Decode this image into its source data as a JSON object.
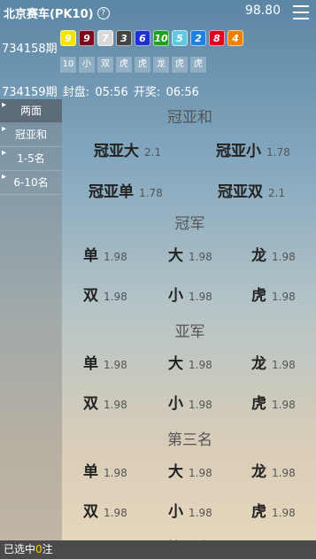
{
  "header": {
    "title": "北京赛车(PK10)",
    "help_icon": "?",
    "balance": "98.80"
  },
  "prev": {
    "period": "734158期",
    "balls": [
      {
        "n": "9",
        "bg": "#f2e500",
        "fg": "#fff"
      },
      {
        "n": "9",
        "bg": "#7a0a1e",
        "fg": "#fff"
      },
      {
        "n": "7",
        "bg": "#d8d8d8",
        "fg": "#fff"
      },
      {
        "n": "3",
        "bg": "#444",
        "fg": "#fff"
      },
      {
        "n": "6",
        "bg": "#2030d0",
        "fg": "#fff"
      },
      {
        "n": "10",
        "bg": "#20a020",
        "fg": "#fff"
      },
      {
        "n": "5",
        "bg": "#60c8e0",
        "fg": "#fff"
      },
      {
        "n": "2",
        "bg": "#2080e0",
        "fg": "#fff"
      },
      {
        "n": "8",
        "bg": "#e00020",
        "fg": "#fff"
      },
      {
        "n": "4",
        "bg": "#f08000",
        "fg": "#fff"
      }
    ],
    "sums": [
      "10",
      "小",
      "双",
      "虎",
      "虎",
      "龙",
      "虎",
      "虎"
    ]
  },
  "next": {
    "period": "734159期",
    "close_label": "封盘:",
    "close_time": "05:56",
    "open_label": "开奖:",
    "open_time": "06:56"
  },
  "side": [
    "两面",
    "冠亚和",
    "1-5名",
    "6-10名"
  ],
  "sections": {
    "gyh": {
      "title": "冠亚和",
      "items": [
        {
          "n": "冠亚大",
          "o": "2.1"
        },
        {
          "n": "冠亚小",
          "o": "1.78"
        },
        {
          "n": "冠亚单",
          "o": "1.78"
        },
        {
          "n": "冠亚双",
          "o": "2.1"
        }
      ]
    },
    "s1": {
      "title": "冠军",
      "items": [
        {
          "n": "单",
          "o": "1.98"
        },
        {
          "n": "大",
          "o": "1.98"
        },
        {
          "n": "龙",
          "o": "1.98"
        },
        {
          "n": "双",
          "o": "1.98"
        },
        {
          "n": "小",
          "o": "1.98"
        },
        {
          "n": "虎",
          "o": "1.98"
        }
      ]
    },
    "s2": {
      "title": "亚军",
      "items": [
        {
          "n": "单",
          "o": "1.98"
        },
        {
          "n": "大",
          "o": "1.98"
        },
        {
          "n": "龙",
          "o": "1.98"
        },
        {
          "n": "双",
          "o": "1.98"
        },
        {
          "n": "小",
          "o": "1.98"
        },
        {
          "n": "虎",
          "o": "1.98"
        }
      ]
    },
    "s3": {
      "title": "第三名",
      "items": [
        {
          "n": "单",
          "o": "1.98"
        },
        {
          "n": "大",
          "o": "1.98"
        },
        {
          "n": "龙",
          "o": "1.98"
        },
        {
          "n": "双",
          "o": "1.98"
        },
        {
          "n": "小",
          "o": "1.98"
        },
        {
          "n": "虎",
          "o": "1.98"
        }
      ]
    },
    "s4": {
      "title": "第四名"
    }
  },
  "footer": {
    "prefix": "已选中",
    "count": "0",
    "suffix": "注"
  }
}
